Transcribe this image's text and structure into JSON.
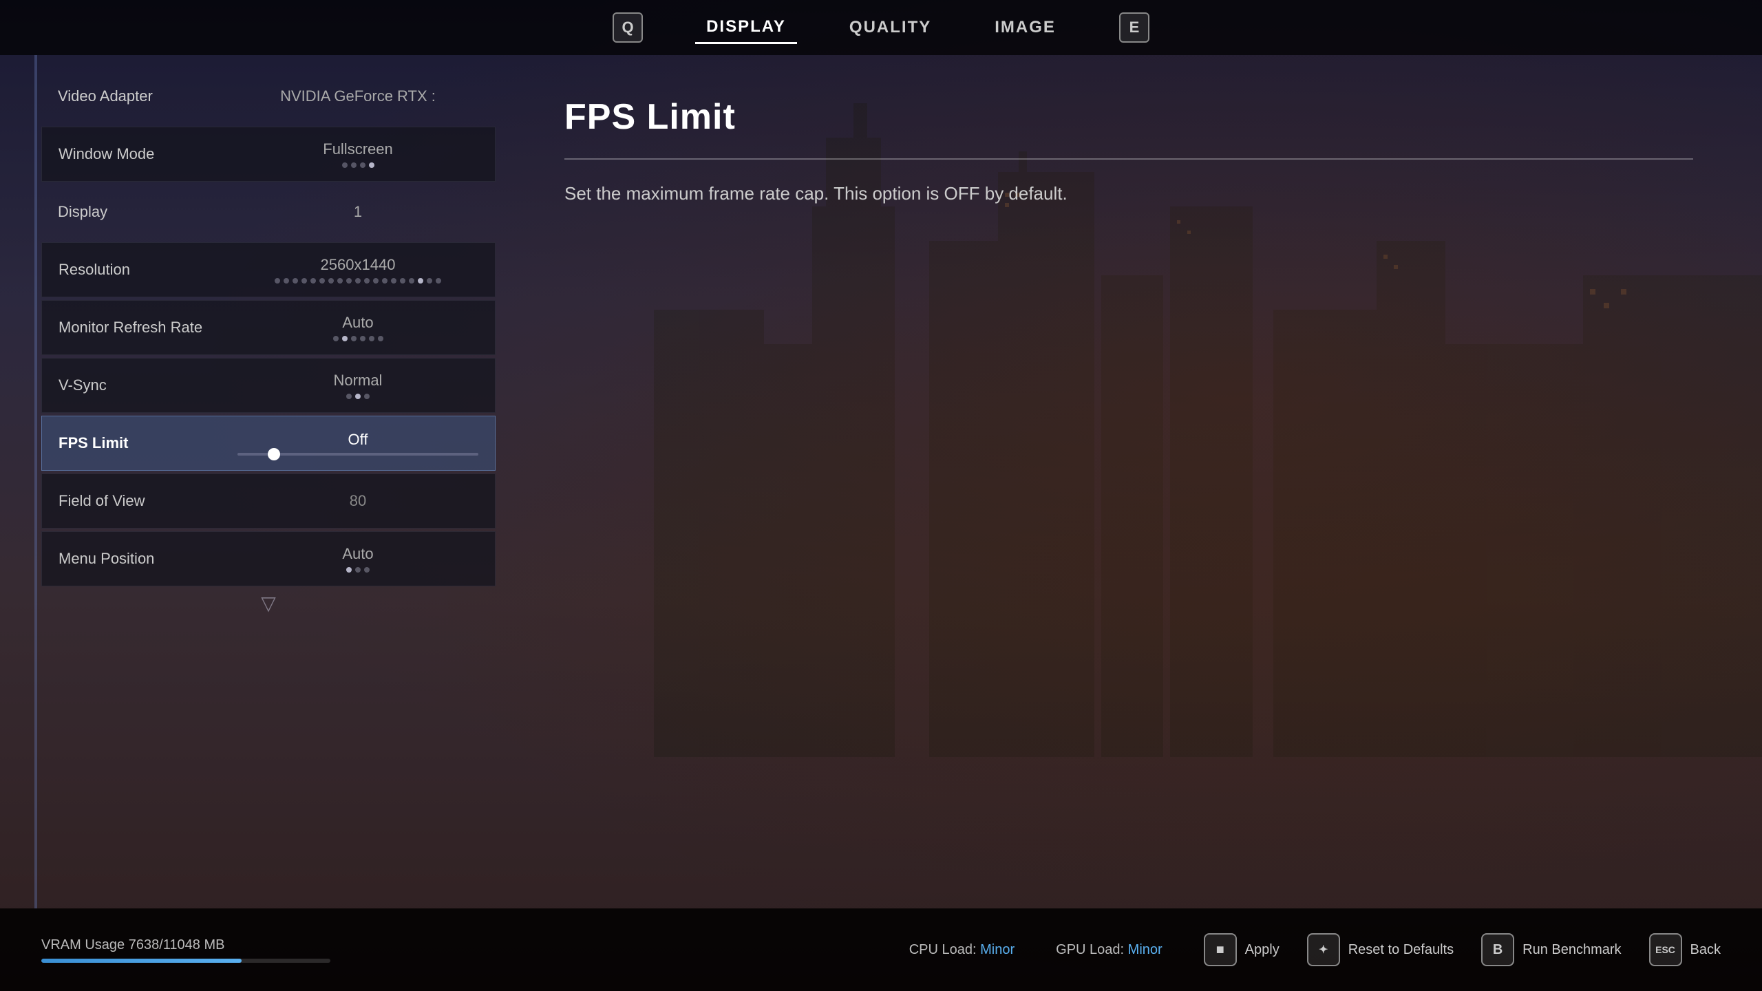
{
  "nav": {
    "tabs": [
      {
        "id": "prev",
        "key": "Q",
        "label": "",
        "active": false,
        "key_only": true
      },
      {
        "id": "display",
        "key": "",
        "label": "DISPLAY",
        "active": true
      },
      {
        "id": "quality",
        "key": "",
        "label": "QUALITY",
        "active": false
      },
      {
        "id": "image",
        "key": "",
        "label": "IMAGE",
        "active": false
      },
      {
        "id": "next",
        "key": "E",
        "label": "",
        "active": false,
        "key_only": true
      }
    ]
  },
  "settings": {
    "items": [
      {
        "id": "video-adapter",
        "label": "Video Adapter",
        "value": "NVIDIA GeForce RTX :",
        "active": false,
        "has_dots": false,
        "dots": []
      },
      {
        "id": "window-mode",
        "label": "Window Mode",
        "value": "Fullscreen",
        "active": false,
        "has_dots": true,
        "dots": [
          false,
          false,
          false,
          true
        ]
      },
      {
        "id": "display",
        "label": "Display",
        "value": "1",
        "active": false,
        "has_dots": false,
        "dots": []
      },
      {
        "id": "resolution",
        "label": "Resolution",
        "value": "2560x1440",
        "active": false,
        "has_dots": true,
        "dots": [
          false,
          false,
          false,
          false,
          false,
          false,
          false,
          false,
          false,
          false,
          false,
          false,
          false,
          false,
          false,
          false,
          true,
          false,
          false
        ]
      },
      {
        "id": "monitor-refresh-rate",
        "label": "Monitor Refresh Rate",
        "value": "Auto",
        "active": false,
        "has_dots": true,
        "dots": [
          false,
          true,
          false,
          false,
          false,
          false
        ]
      },
      {
        "id": "vsync",
        "label": "V-Sync",
        "value": "Normal",
        "active": false,
        "has_dots": true,
        "dots": [
          false,
          true,
          false
        ]
      },
      {
        "id": "fps-limit",
        "label": "FPS Limit",
        "value": "Off",
        "active": true,
        "has_slider": true,
        "slider_pct": 15
      },
      {
        "id": "field-of-view",
        "label": "Field of View",
        "value": "80",
        "active": false,
        "has_dots": false
      },
      {
        "id": "menu-position",
        "label": "Menu Position",
        "value": "Auto",
        "active": false,
        "has_dots": true,
        "dots": [
          true,
          false,
          false
        ]
      }
    ]
  },
  "description": {
    "title": "FPS Limit",
    "text": "Set the maximum frame rate cap. This option is OFF by default."
  },
  "bottom": {
    "vram_label": "VRAM Usage 7638/11048 MB",
    "vram_pct": 69.3,
    "cpu_label": "CPU Load:",
    "cpu_value": "Minor",
    "gpu_label": "GPU Load:",
    "gpu_value": "Minor",
    "buttons": [
      {
        "id": "apply",
        "key": "■",
        "label": "Apply"
      },
      {
        "id": "reset",
        "key": "✦",
        "label": "Reset to Defaults"
      },
      {
        "id": "benchmark",
        "key": "B",
        "label": "Run Benchmark"
      },
      {
        "id": "back",
        "key": "ESC",
        "label": "Back"
      }
    ]
  }
}
